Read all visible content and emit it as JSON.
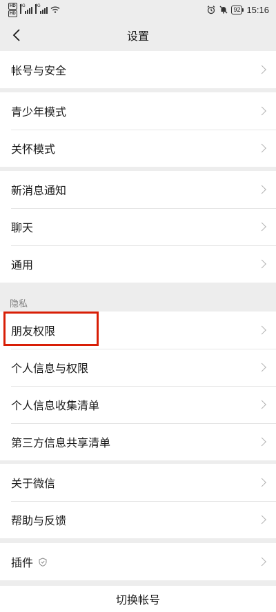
{
  "status_bar": {
    "sim_labels": [
      "HD",
      "HD"
    ],
    "network1": "4G",
    "network2": "4G",
    "battery": "92",
    "time": "15:16"
  },
  "nav": {
    "title": "设置"
  },
  "groups": [
    {
      "items": [
        "帐号与安全"
      ]
    },
    {
      "items": [
        "青少年模式",
        "关怀模式"
      ]
    },
    {
      "items": [
        "新消息通知",
        "聊天",
        "通用"
      ]
    },
    {
      "label": "隐私",
      "items": [
        "朋友权限",
        "个人信息与权限",
        "个人信息收集清单",
        "第三方信息共享清单"
      ]
    },
    {
      "items": [
        "关于微信",
        "帮助与反馈"
      ]
    },
    {
      "items": [
        "插件"
      ]
    }
  ],
  "switch_account": "切换帐号",
  "colors": {
    "background": "#ededed",
    "cell": "#ffffff",
    "highlight": "#d81e06",
    "chevron": "#b2b2b2"
  }
}
